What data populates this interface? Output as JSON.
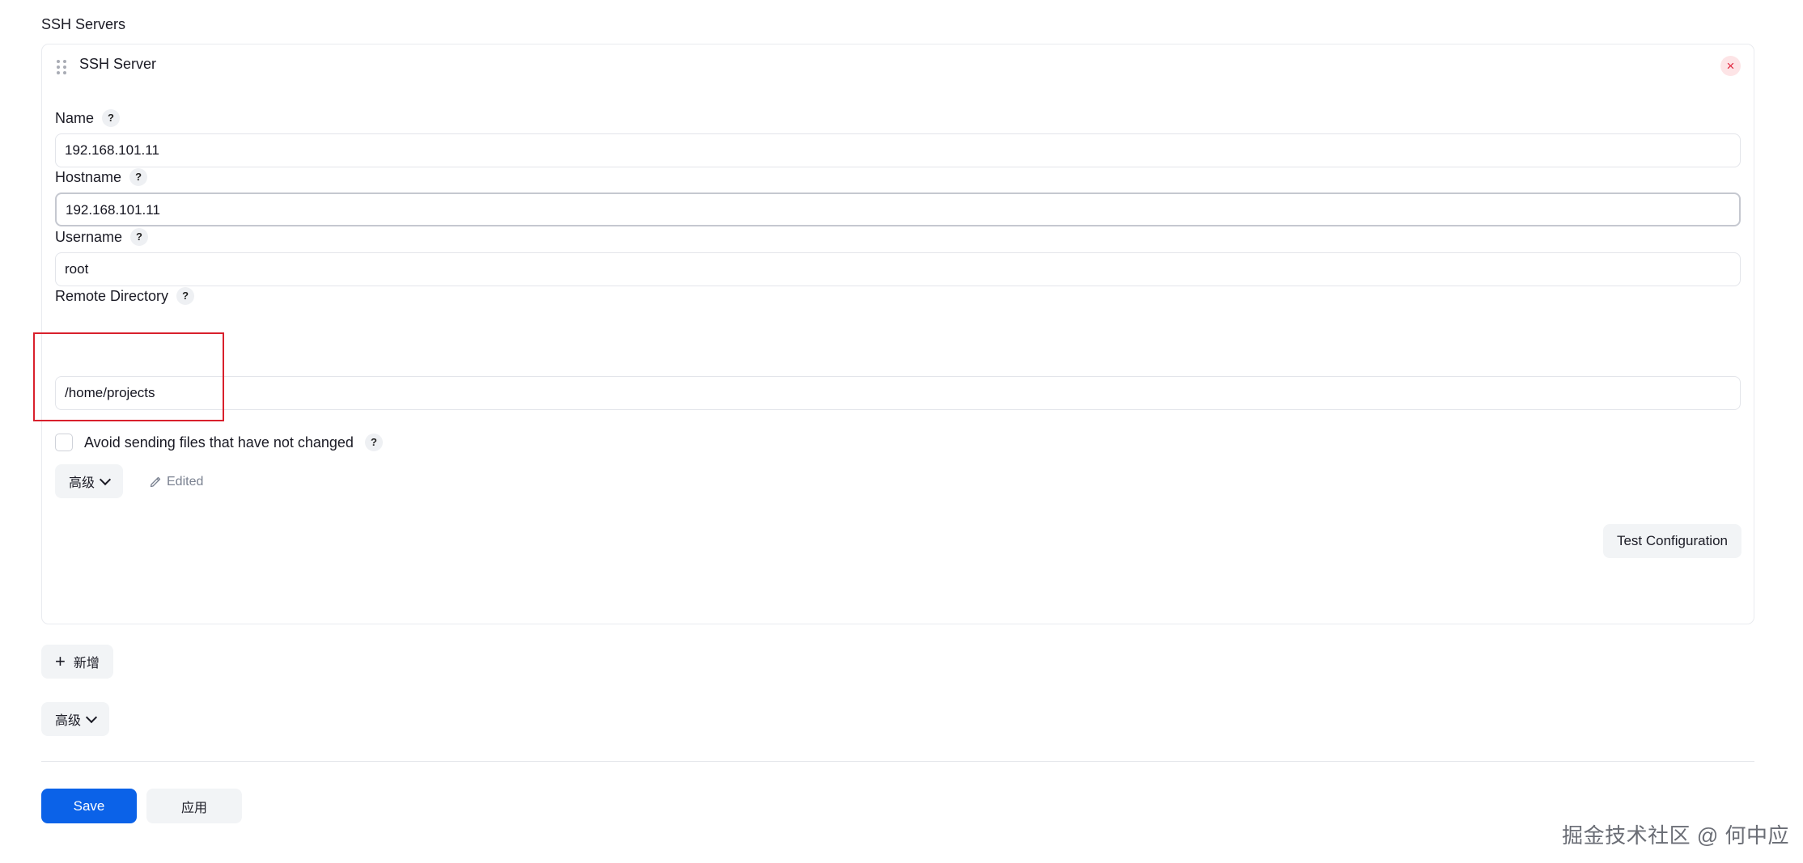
{
  "section": {
    "title": "SSH Servers"
  },
  "server": {
    "title": "SSH Server",
    "close_icon": "×",
    "fields": {
      "name": {
        "label": "Name",
        "value": "192.168.101.11"
      },
      "hostname": {
        "label": "Hostname",
        "value": "192.168.101.11"
      },
      "username": {
        "label": "Username",
        "value": "root"
      },
      "remote_directory": {
        "label": "Remote Directory",
        "value": "/home/projects"
      }
    },
    "help_glyph": "?",
    "checkbox_label": "Avoid sending files that have not changed",
    "advanced_label": "高级",
    "edited_label": "Edited",
    "test_label": "Test Configuration"
  },
  "add_label": "新增",
  "add_icon": "+",
  "advanced_label": "高级",
  "actions": {
    "save_label": "Save",
    "apply_label": "应用"
  },
  "watermark": "掘金技术社区 @ 何中应",
  "colors": {
    "primary": "#0b62e8",
    "danger": "#e0243d",
    "highlight": "#d9202c"
  }
}
